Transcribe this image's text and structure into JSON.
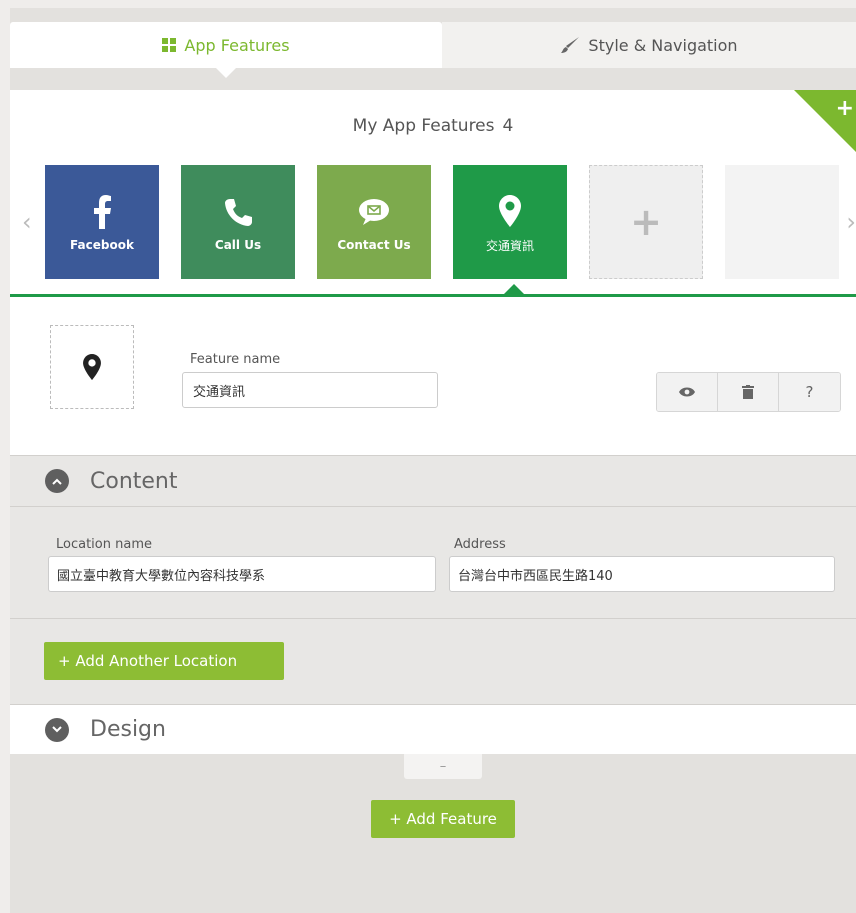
{
  "tabs": {
    "app_features": "App Features",
    "style_navigation": "Style & Navigation"
  },
  "features": {
    "title": "My App Features",
    "count": "4",
    "corner_label": "+",
    "items": [
      {
        "label": "Facebook",
        "icon": "facebook-icon",
        "color": "#3b5998"
      },
      {
        "label": "Call Us",
        "icon": "phone-icon",
        "color": "#3f8c5c"
      },
      {
        "label": "Contact Us",
        "icon": "chat-mail-icon",
        "color": "#7daa4d"
      },
      {
        "label": "交通資訊",
        "icon": "map-pin-icon",
        "color": "#1f9a48"
      }
    ],
    "add_tile": "+"
  },
  "detail": {
    "feature_name_label": "Feature name",
    "feature_name_value": "交通資訊",
    "buttons": {
      "preview": "eye-icon",
      "delete": "trash-icon",
      "help": "?"
    }
  },
  "content": {
    "title": "Content",
    "location_name_label": "Location name",
    "location_name_value": "國立臺中教育大學數位內容科技學系",
    "address_label": "Address",
    "address_value": "台灣台中市西區民生路140",
    "add_location": "+  Add Another Location"
  },
  "design": {
    "title": "Design"
  },
  "footer": {
    "collapse": "–",
    "add_feature": "+ Add Feature"
  },
  "colors": {
    "accent": "#7cb82f",
    "button_green": "#8dbd34",
    "selected_green": "#1f9a48"
  }
}
